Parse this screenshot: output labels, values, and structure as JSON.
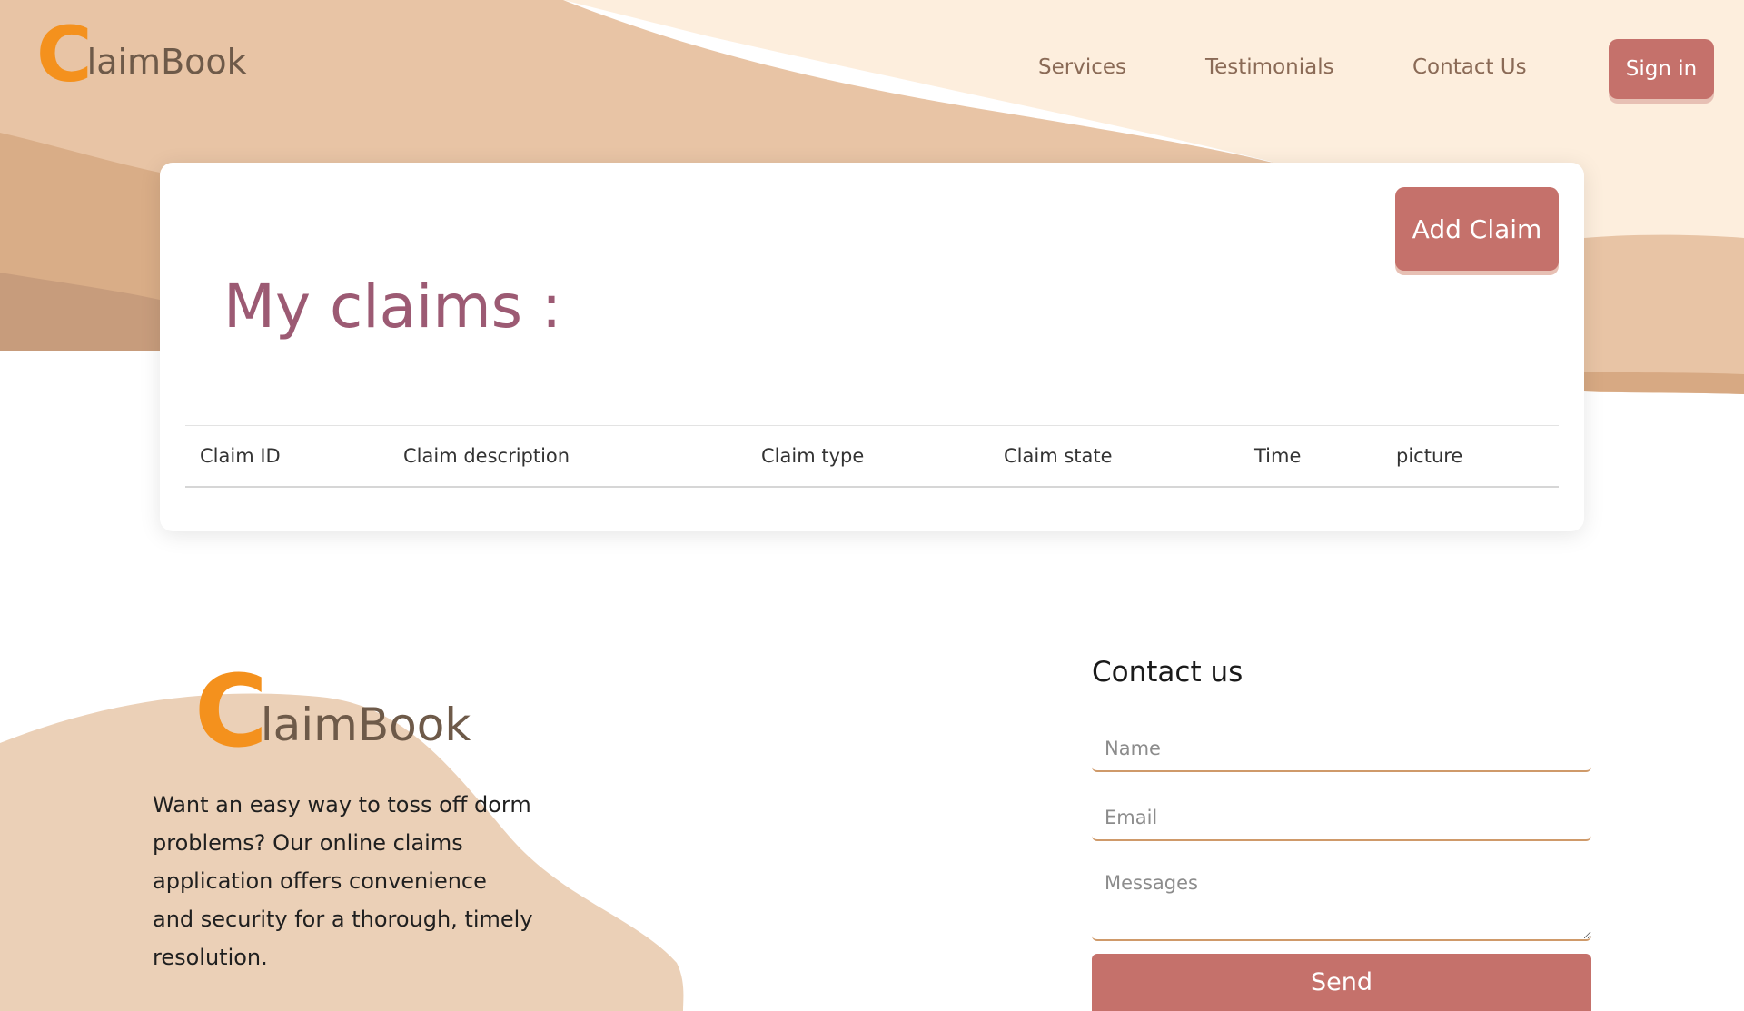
{
  "brand": {
    "logo_initial": "C",
    "logo_rest": "laimBook"
  },
  "nav": {
    "services": "Services",
    "testimonials": "Testimonials",
    "contact": "Contact Us",
    "sign_in": "Sign in"
  },
  "claims": {
    "add_button": "Add Claim",
    "title": "My claims :",
    "columns": [
      "Claim ID",
      "Claim description",
      "Claim type",
      "Claim state",
      "Time",
      "picture"
    ]
  },
  "footer": {
    "description": "Want an easy way to toss off dorm problems? Our online claims application offers convenience and security for a thorough, timely resolution.",
    "contact_heading": "Contact us",
    "name_placeholder": "Name",
    "email_placeholder": "Email",
    "messages_placeholder": "Messages",
    "send": "Send"
  },
  "colors": {
    "accent": "#c5716b",
    "logo_orange": "#f4911d",
    "title_mauve": "#9c5a73",
    "wave_light": "#fdeedd",
    "wave_mid": "#e8c4a5",
    "wave_dark": "#d7a983"
  }
}
